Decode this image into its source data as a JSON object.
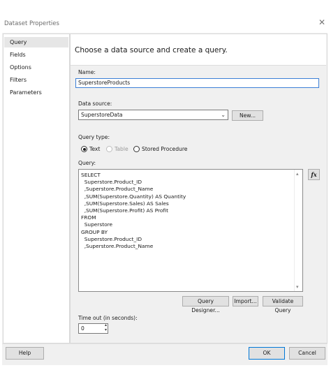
{
  "window": {
    "title": "Dataset Properties",
    "close": "✕"
  },
  "nav": {
    "items": [
      "Query",
      "Fields",
      "Options",
      "Filters",
      "Parameters"
    ]
  },
  "header": {
    "text": "Choose a data source and create a query."
  },
  "name_field": {
    "label": "Name:",
    "value": "SuperstoreProducts"
  },
  "data_source": {
    "label": "Data source:",
    "value": "SuperstoreData",
    "new_label": "New..."
  },
  "query_type": {
    "label": "Query type:",
    "options": [
      "Text",
      "Table",
      "Stored Procedure"
    ],
    "selected": "Text"
  },
  "query": {
    "label": "Query:",
    "text": "SELECT\n  Superstore.Product_ID\n  ,Superstore.Product_Name\n  ,SUM(Superstore.Quantity) AS Quantity\n  ,SUM(Superstore.Sales) AS Sales\n  ,SUM(Superstore.Profit) AS Profit\nFROM\n  Superstore\nGROUP BY\n  Superstore.Product_ID\n  ,Superstore.Product_Name",
    "fx_label": "fx"
  },
  "query_buttons": {
    "designer": "Query Designer...",
    "import": "Import...",
    "validate": "Validate Query"
  },
  "timeout": {
    "label": "Time out (in seconds):",
    "value": "0"
  },
  "footer": {
    "help": "Help",
    "ok": "OK",
    "cancel": "Cancel"
  }
}
